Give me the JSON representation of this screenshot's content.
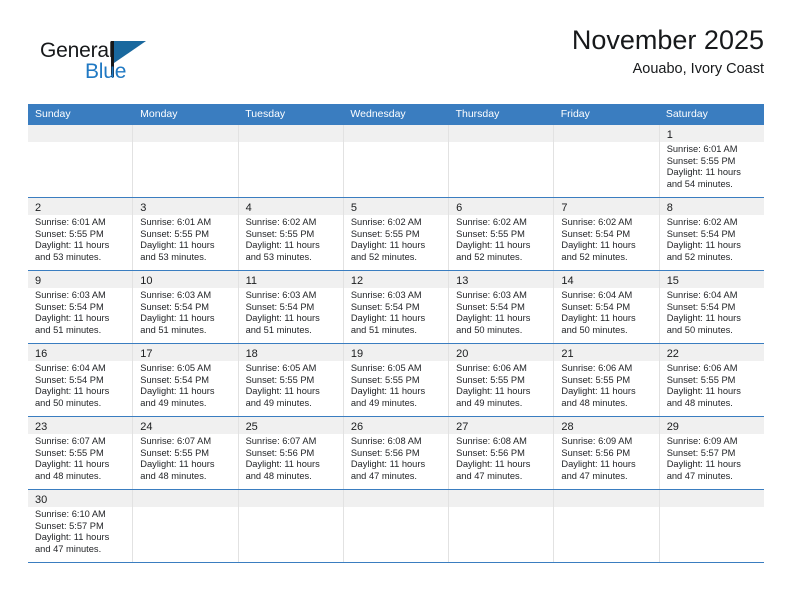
{
  "brand": {
    "name_top": "General",
    "name_bottom": "Blue",
    "accent_color": "#19689e",
    "text_color": "#16181a"
  },
  "header": {
    "title": "November 2025",
    "subtitle": "Aouabo, Ivory Coast"
  },
  "theme": {
    "header_band": "#3a7dc0",
    "day_band": "#f0f0f0",
    "row_divider": "#3a7dc0",
    "cell_border": "#e2e2e2",
    "text": "#232528"
  },
  "weekdays": [
    "Sunday",
    "Monday",
    "Tuesday",
    "Wednesday",
    "Thursday",
    "Friday",
    "Saturday"
  ],
  "weeks": [
    [
      {
        "day": "",
        "lines": []
      },
      {
        "day": "",
        "lines": []
      },
      {
        "day": "",
        "lines": []
      },
      {
        "day": "",
        "lines": []
      },
      {
        "day": "",
        "lines": []
      },
      {
        "day": "",
        "lines": []
      },
      {
        "day": "1",
        "lines": [
          "Sunrise: 6:01 AM",
          "Sunset: 5:55 PM",
          "Daylight: 11 hours",
          "and 54 minutes."
        ]
      }
    ],
    [
      {
        "day": "2",
        "lines": [
          "Sunrise: 6:01 AM",
          "Sunset: 5:55 PM",
          "Daylight: 11 hours",
          "and 53 minutes."
        ]
      },
      {
        "day": "3",
        "lines": [
          "Sunrise: 6:01 AM",
          "Sunset: 5:55 PM",
          "Daylight: 11 hours",
          "and 53 minutes."
        ]
      },
      {
        "day": "4",
        "lines": [
          "Sunrise: 6:02 AM",
          "Sunset: 5:55 PM",
          "Daylight: 11 hours",
          "and 53 minutes."
        ]
      },
      {
        "day": "5",
        "lines": [
          "Sunrise: 6:02 AM",
          "Sunset: 5:55 PM",
          "Daylight: 11 hours",
          "and 52 minutes."
        ]
      },
      {
        "day": "6",
        "lines": [
          "Sunrise: 6:02 AM",
          "Sunset: 5:55 PM",
          "Daylight: 11 hours",
          "and 52 minutes."
        ]
      },
      {
        "day": "7",
        "lines": [
          "Sunrise: 6:02 AM",
          "Sunset: 5:54 PM",
          "Daylight: 11 hours",
          "and 52 minutes."
        ]
      },
      {
        "day": "8",
        "lines": [
          "Sunrise: 6:02 AM",
          "Sunset: 5:54 PM",
          "Daylight: 11 hours",
          "and 52 minutes."
        ]
      }
    ],
    [
      {
        "day": "9",
        "lines": [
          "Sunrise: 6:03 AM",
          "Sunset: 5:54 PM",
          "Daylight: 11 hours",
          "and 51 minutes."
        ]
      },
      {
        "day": "10",
        "lines": [
          "Sunrise: 6:03 AM",
          "Sunset: 5:54 PM",
          "Daylight: 11 hours",
          "and 51 minutes."
        ]
      },
      {
        "day": "11",
        "lines": [
          "Sunrise: 6:03 AM",
          "Sunset: 5:54 PM",
          "Daylight: 11 hours",
          "and 51 minutes."
        ]
      },
      {
        "day": "12",
        "lines": [
          "Sunrise: 6:03 AM",
          "Sunset: 5:54 PM",
          "Daylight: 11 hours",
          "and 51 minutes."
        ]
      },
      {
        "day": "13",
        "lines": [
          "Sunrise: 6:03 AM",
          "Sunset: 5:54 PM",
          "Daylight: 11 hours",
          "and 50 minutes."
        ]
      },
      {
        "day": "14",
        "lines": [
          "Sunrise: 6:04 AM",
          "Sunset: 5:54 PM",
          "Daylight: 11 hours",
          "and 50 minutes."
        ]
      },
      {
        "day": "15",
        "lines": [
          "Sunrise: 6:04 AM",
          "Sunset: 5:54 PM",
          "Daylight: 11 hours",
          "and 50 minutes."
        ]
      }
    ],
    [
      {
        "day": "16",
        "lines": [
          "Sunrise: 6:04 AM",
          "Sunset: 5:54 PM",
          "Daylight: 11 hours",
          "and 50 minutes."
        ]
      },
      {
        "day": "17",
        "lines": [
          "Sunrise: 6:05 AM",
          "Sunset: 5:54 PM",
          "Daylight: 11 hours",
          "and 49 minutes."
        ]
      },
      {
        "day": "18",
        "lines": [
          "Sunrise: 6:05 AM",
          "Sunset: 5:55 PM",
          "Daylight: 11 hours",
          "and 49 minutes."
        ]
      },
      {
        "day": "19",
        "lines": [
          "Sunrise: 6:05 AM",
          "Sunset: 5:55 PM",
          "Daylight: 11 hours",
          "and 49 minutes."
        ]
      },
      {
        "day": "20",
        "lines": [
          "Sunrise: 6:06 AM",
          "Sunset: 5:55 PM",
          "Daylight: 11 hours",
          "and 49 minutes."
        ]
      },
      {
        "day": "21",
        "lines": [
          "Sunrise: 6:06 AM",
          "Sunset: 5:55 PM",
          "Daylight: 11 hours",
          "and 48 minutes."
        ]
      },
      {
        "day": "22",
        "lines": [
          "Sunrise: 6:06 AM",
          "Sunset: 5:55 PM",
          "Daylight: 11 hours",
          "and 48 minutes."
        ]
      }
    ],
    [
      {
        "day": "23",
        "lines": [
          "Sunrise: 6:07 AM",
          "Sunset: 5:55 PM",
          "Daylight: 11 hours",
          "and 48 minutes."
        ]
      },
      {
        "day": "24",
        "lines": [
          "Sunrise: 6:07 AM",
          "Sunset: 5:55 PM",
          "Daylight: 11 hours",
          "and 48 minutes."
        ]
      },
      {
        "day": "25",
        "lines": [
          "Sunrise: 6:07 AM",
          "Sunset: 5:56 PM",
          "Daylight: 11 hours",
          "and 48 minutes."
        ]
      },
      {
        "day": "26",
        "lines": [
          "Sunrise: 6:08 AM",
          "Sunset: 5:56 PM",
          "Daylight: 11 hours",
          "and 47 minutes."
        ]
      },
      {
        "day": "27",
        "lines": [
          "Sunrise: 6:08 AM",
          "Sunset: 5:56 PM",
          "Daylight: 11 hours",
          "and 47 minutes."
        ]
      },
      {
        "day": "28",
        "lines": [
          "Sunrise: 6:09 AM",
          "Sunset: 5:56 PM",
          "Daylight: 11 hours",
          "and 47 minutes."
        ]
      },
      {
        "day": "29",
        "lines": [
          "Sunrise: 6:09 AM",
          "Sunset: 5:57 PM",
          "Daylight: 11 hours",
          "and 47 minutes."
        ]
      }
    ],
    [
      {
        "day": "30",
        "lines": [
          "Sunrise: 6:10 AM",
          "Sunset: 5:57 PM",
          "Daylight: 11 hours",
          "and 47 minutes."
        ]
      },
      {
        "day": "",
        "lines": []
      },
      {
        "day": "",
        "lines": []
      },
      {
        "day": "",
        "lines": []
      },
      {
        "day": "",
        "lines": []
      },
      {
        "day": "",
        "lines": []
      },
      {
        "day": "",
        "lines": []
      }
    ]
  ]
}
